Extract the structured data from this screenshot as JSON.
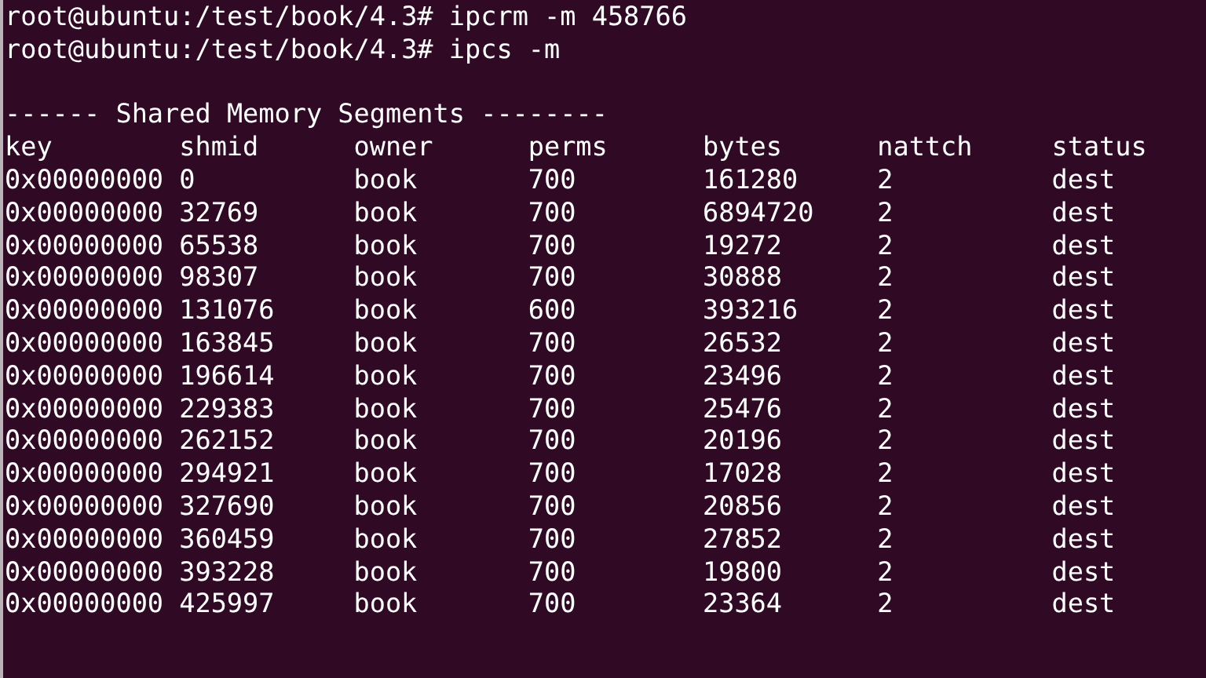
{
  "commands": [
    {
      "prompt": "root@ubuntu:/test/book/4.3#",
      "command": "ipcrm -m 458766"
    },
    {
      "prompt": "root@ubuntu:/test/book/4.3#",
      "command": "ipcs -m"
    }
  ],
  "section_header": "------ Shared Memory Segments --------",
  "table": {
    "columns": [
      "key",
      "shmid",
      "owner",
      "perms",
      "bytes",
      "nattch",
      "status"
    ],
    "rows": [
      [
        "0x00000000",
        "0",
        "book",
        "700",
        "161280",
        "2",
        "dest"
      ],
      [
        "0x00000000",
        "32769",
        "book",
        "700",
        "6894720",
        "2",
        "dest"
      ],
      [
        "0x00000000",
        "65538",
        "book",
        "700",
        "19272",
        "2",
        "dest"
      ],
      [
        "0x00000000",
        "98307",
        "book",
        "700",
        "30888",
        "2",
        "dest"
      ],
      [
        "0x00000000",
        "131076",
        "book",
        "600",
        "393216",
        "2",
        "dest"
      ],
      [
        "0x00000000",
        "163845",
        "book",
        "700",
        "26532",
        "2",
        "dest"
      ],
      [
        "0x00000000",
        "196614",
        "book",
        "700",
        "23496",
        "2",
        "dest"
      ],
      [
        "0x00000000",
        "229383",
        "book",
        "700",
        "25476",
        "2",
        "dest"
      ],
      [
        "0x00000000",
        "262152",
        "book",
        "700",
        "20196",
        "2",
        "dest"
      ],
      [
        "0x00000000",
        "294921",
        "book",
        "700",
        "17028",
        "2",
        "dest"
      ],
      [
        "0x00000000",
        "327690",
        "book",
        "700",
        "20856",
        "2",
        "dest"
      ],
      [
        "0x00000000",
        "360459",
        "book",
        "700",
        "27852",
        "2",
        "dest"
      ],
      [
        "0x00000000",
        "393228",
        "book",
        "700",
        "19800",
        "2",
        "dest"
      ],
      [
        "0x00000000",
        "425997",
        "book",
        "700",
        "23364",
        "2",
        "dest"
      ]
    ]
  }
}
